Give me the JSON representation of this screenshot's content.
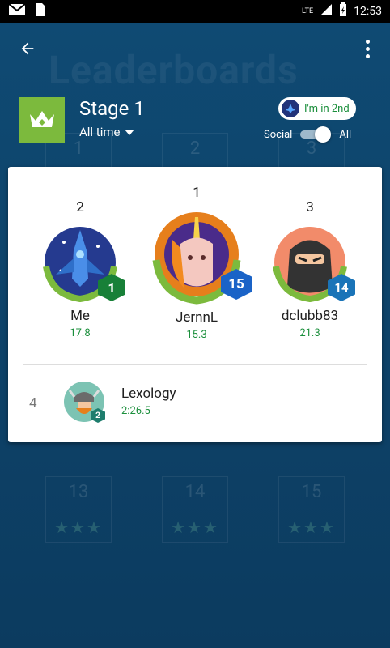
{
  "status_bar": {
    "network": "LTE",
    "time": "12:53"
  },
  "background": {
    "watermark": "Leaderboards",
    "cells": [
      {
        "label": "1"
      },
      {
        "label": "2"
      },
      {
        "label": "3"
      },
      {
        "label": "13"
      },
      {
        "label": "14"
      },
      {
        "label": "15"
      }
    ]
  },
  "stage": {
    "title": "Stage 1",
    "time_filter": "All time"
  },
  "rank_pill": {
    "label": "I'm in 2nd"
  },
  "toggle": {
    "left_label": "Social",
    "right_label": "All",
    "selected": "All"
  },
  "podium": [
    {
      "rank": "2",
      "name": "Me",
      "score": "17.8",
      "level": "1",
      "badge_color": "#188038"
    },
    {
      "rank": "1",
      "name": "JernnL",
      "score": "15.3",
      "level": "15",
      "badge_color": "#1a63c7"
    },
    {
      "rank": "3",
      "name": "dclubb83",
      "score": "21.3",
      "level": "14",
      "badge_color": "#1a74b8"
    }
  ],
  "list": [
    {
      "rank": "4",
      "name": "Lexology",
      "score": "2:26.5",
      "level": "2"
    }
  ]
}
